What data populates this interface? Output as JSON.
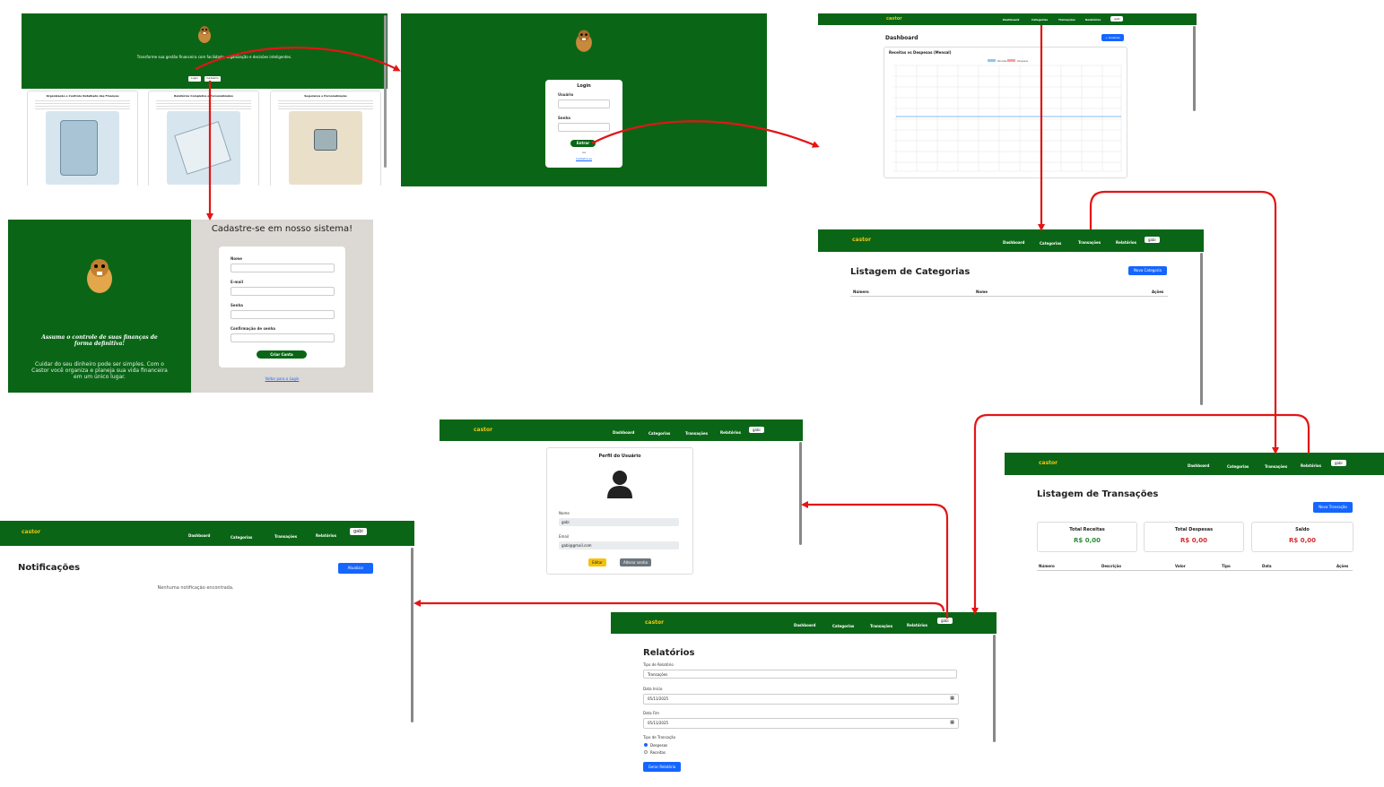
{
  "colors": {
    "brand_green": "#0a6616",
    "accent_blue": "#1565ff",
    "flow_arrow": "#e31515",
    "danger": "#d32f2f"
  },
  "landing": {
    "tagline": "Transforme sua gestão financeira com facilidade, organização e decisões inteligentes.",
    "btn1": "Login",
    "btn2": "Cadastro",
    "card_titles": [
      "Organização e Controle Detalhado das Finanças",
      "Relatórios Completos e Personalizados",
      "Segurança e Personalização"
    ]
  },
  "login": {
    "title": "Login",
    "user_label": "Usuário",
    "pass_label": "Senha",
    "submit": "Entrar",
    "or": "ou",
    "register_link": "Cadastre-se"
  },
  "register": {
    "title": "Cadastre-se em nosso sistema!",
    "slogan": "Assuma o controle de suas finanças de forma definitiva!",
    "description": "Cuidar do seu dinheiro pode ser simples. Com o Castor você organiza e planeja sua vida financeira em um único lugar.",
    "fields": [
      "Nome",
      "E-mail",
      "Senha",
      "Confirmação de senha"
    ],
    "submit": "Criar Conta",
    "back_link": "Voltar para o Login"
  },
  "nav": {
    "logo": "castor",
    "items": [
      "Dashboard",
      "Categorias",
      "Transações",
      "Relatórios"
    ],
    "user": "gabi"
  },
  "dashboard": {
    "title": "Dashboard",
    "button": "+ Atualizar",
    "chart_title": "Receitas vs Despesas (Mensal)",
    "legend": [
      "Receitas",
      "Despesas"
    ]
  },
  "categorias": {
    "title": "Listagem de Categorias",
    "button": "Nova Categoria",
    "headers": [
      "Número",
      "Nome",
      "Ações"
    ]
  },
  "transacoes": {
    "title": "Listagem de Transações",
    "button": "Nova Transação",
    "totals": [
      {
        "label": "Total Receitas",
        "value": "R$ 0,00"
      },
      {
        "label": "Total Despesas",
        "value": "R$ 0,00"
      },
      {
        "label": "Saldo",
        "value": "R$ 0,00"
      }
    ],
    "headers": [
      "Número",
      "Descrição",
      "Valor",
      "Tipo",
      "Data",
      "Ações"
    ]
  },
  "perfil": {
    "title": "Perfil do Usuário",
    "name_label": "Nome",
    "name_value": "gabi",
    "email_label": "Email",
    "email_value": "gabi@gmail.com",
    "edit": "Editar",
    "change_pass": "Alterar senha"
  },
  "notificacoes": {
    "title": "Notificações",
    "button": "Atualizar",
    "empty": "Nenhuma notificação encontrada."
  },
  "relatorios": {
    "title": "Relatórios",
    "type_label": "Tipo de Relatório",
    "type_value": "Transações",
    "start_label": "Data Início",
    "start_value": "05/11/2025",
    "end_label": "Data Fim",
    "end_value": "05/11/2025",
    "trans_type_label": "Tipo de Transação",
    "options": [
      "Despesas",
      "Receitas"
    ],
    "submit": "Gerar Relatório"
  }
}
